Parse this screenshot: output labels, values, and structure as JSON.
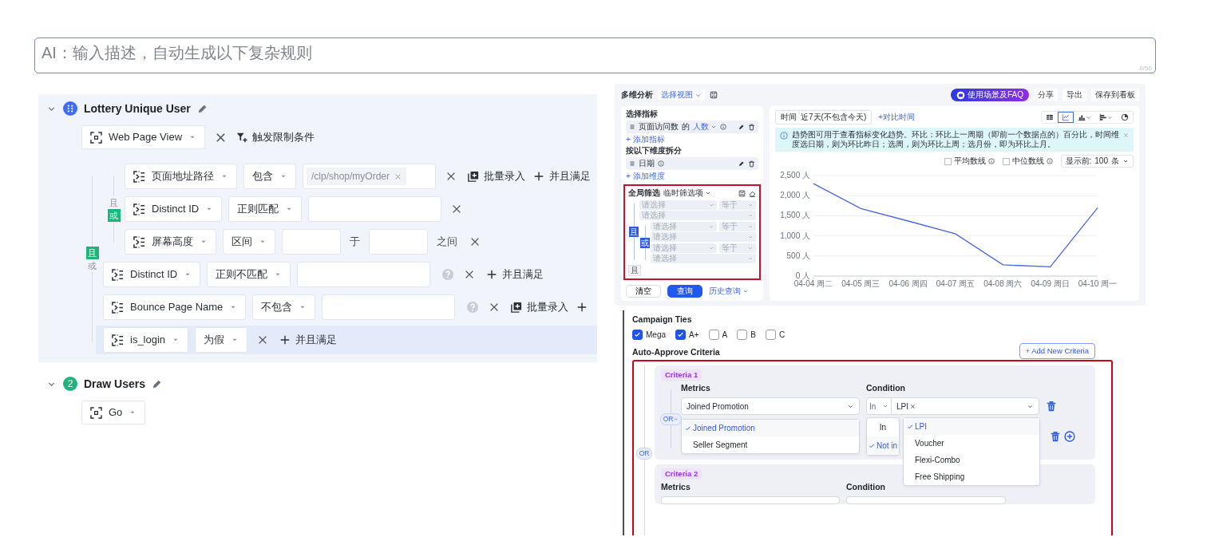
{
  "prompt_box": {
    "placeholder": "AI：输入描述，自动生成以下复杂规则",
    "counter": "0/50"
  },
  "rule_groups": [
    {
      "kind": "icon",
      "title": "Lottery Unique User",
      "expanded": true,
      "active": true,
      "event": {
        "label": "Web Page View"
      },
      "trigger_action": "触发限制条件",
      "conditions": {
        "logic": [
          {
            "label": "且",
            "selected": true
          },
          {
            "label": "或",
            "selected": false
          }
        ],
        "children": [
          {
            "logic": [
              {
                "label": "且",
                "selected": false
              },
              {
                "label": "或",
                "selected": true
              }
            ],
            "children": [
              {
                "highlighted": false,
                "parts": [
                  {
                    "kind": "field",
                    "text": "页面地址路径"
                  },
                  {
                    "kind": "operator",
                    "text": "包含"
                  },
                  {
                    "kind": "tags",
                    "tags": [
                      "/clp/shop/myOrder"
                    ]
                  },
                  {
                    "kind": "remove"
                  },
                  {
                    "kind": "bulk",
                    "text": "批量录入"
                  },
                  {
                    "kind": "add",
                    "text": "并且满足"
                  }
                ]
              },
              {
                "highlighted": false,
                "parts": [
                  {
                    "kind": "field",
                    "text": "Distinct ID"
                  },
                  {
                    "kind": "operator",
                    "text": "正则匹配"
                  },
                  {
                    "kind": "input"
                  },
                  {
                    "kind": "remove"
                  }
                ]
              },
              {
                "highlighted": false,
                "parts": [
                  {
                    "kind": "field",
                    "text": "屏幕高度"
                  },
                  {
                    "kind": "operator",
                    "text": "区间"
                  },
                  {
                    "kind": "range-input"
                  },
                  {
                    "kind": "text",
                    "text": "于"
                  },
                  {
                    "kind": "range-input"
                  },
                  {
                    "kind": "text",
                    "text": "之间"
                  },
                  {
                    "kind": "remove"
                  }
                ]
              }
            ]
          },
          {
            "highlighted": false,
            "parts": [
              {
                "kind": "field",
                "text": "Distinct ID"
              },
              {
                "kind": "operator",
                "text": "正则不匹配"
              },
              {
                "kind": "input"
              },
              {
                "kind": "help"
              },
              {
                "kind": "remove"
              },
              {
                "kind": "add",
                "text": "并且满足"
              }
            ]
          },
          {
            "highlighted": false,
            "parts": [
              {
                "kind": "field",
                "text": "Bounce Page Name"
              },
              {
                "kind": "operator",
                "text": "不包含"
              },
              {
                "kind": "input"
              },
              {
                "kind": "help"
              },
              {
                "kind": "remove"
              },
              {
                "kind": "bulk",
                "text": "批量录入"
              },
              {
                "kind": "add"
              }
            ]
          },
          {
            "highlighted": true,
            "parts": [
              {
                "kind": "field",
                "text": "is_login"
              },
              {
                "kind": "operator",
                "text": "为假"
              },
              {
                "kind": "remove"
              },
              {
                "kind": "add",
                "text": "并且满足"
              }
            ]
          }
        ]
      }
    },
    {
      "kind": "number",
      "badge": "2",
      "title": "Draw Users",
      "expanded": true,
      "active": false,
      "event": {
        "label": "Go"
      }
    }
  ],
  "analytics_view": {
    "title": "多维分析",
    "view_select": "选择视图",
    "header_buttons": [
      {
        "kind": "faq",
        "label": "使用场景及FAQ"
      },
      {
        "kind": "plain",
        "label": "分享"
      },
      {
        "kind": "plain",
        "label": "导出"
      },
      {
        "kind": "plain",
        "label": "保存到看板"
      }
    ],
    "metrics": {
      "heading": "选择指标",
      "items": [
        {
          "name": "页面访问数",
          "joiner": "的",
          "measure": "人数"
        }
      ],
      "add_link": "+ 添加指标"
    },
    "dimensions": {
      "heading": "按以下维度拆分",
      "items": [
        {
          "name": "日期"
        }
      ],
      "add_link": "+ 添加维度"
    },
    "global_filter": {
      "heading": "全局筛选",
      "mode": "临时筛选项",
      "highlighted": true,
      "group": {
        "logic": "且",
        "children": [
          {
            "field": {
              "placeholder": "请选择"
            },
            "operator": "等于",
            "value": {
              "placeholder": "请选择"
            }
          },
          {
            "logic": "或",
            "children": [
              {
                "field": {
                  "placeholder": "请选择"
                },
                "operator": "等于",
                "value": {
                  "placeholder": "请选择"
                }
              },
              {
                "field": {
                  "placeholder": "请选择"
                },
                "operator": "等于",
                "value": {
                  "placeholder": "请选择"
                }
              }
            ]
          }
        ]
      },
      "add_logic": "且"
    },
    "actions": [
      {
        "kind": "outline",
        "label": "清空"
      },
      {
        "kind": "primary",
        "label": "查询"
      },
      {
        "kind": "link",
        "label": "历史查询"
      }
    ],
    "time_label": "时间",
    "time_value": "近7天(不包含今天)",
    "compare_link": "+对比时间",
    "chart_types": [
      {
        "kind": "table",
        "selected": false
      },
      {
        "kind": "line",
        "selected": true
      },
      {
        "kind": "bar",
        "selected": false
      },
      {
        "kind": "hbar",
        "selected": false
      },
      {
        "kind": "pie",
        "selected": false
      }
    ],
    "notice": "趋势图可用于查看指标变化趋势。环比：环比上一周期（即前一个数据点的）百分比，时间维度选日期，则为环比昨日；选周，则为环比上周；选月份，即为环比上月。",
    "reference_lines": [
      {
        "label": "平均数线",
        "checked": false
      },
      {
        "label": "中位数线",
        "checked": false
      }
    ],
    "top_select": {
      "label": "显示前:",
      "value": "100",
      "unit": "条"
    },
    "chart_data": {
      "type": "line",
      "categories": [
        "04-04 周二",
        "04-05 周三",
        "04-06 周四",
        "04-07 周五",
        "04-08 周六",
        "04-09 周日",
        "04-10 周一"
      ],
      "series": [
        {
          "color": "#4a66e8",
          "values": [
            2300,
            1680,
            1370,
            1050,
            280,
            230,
            1700
          ]
        }
      ],
      "ylim": [
        0,
        2500
      ],
      "grid": true,
      "yticks": [
        {
          "value": 0,
          "label": "0 人"
        },
        {
          "value": 500,
          "label": "500 人"
        },
        {
          "value": 1000,
          "label": "1,000 人"
        },
        {
          "value": 1500,
          "label": "1,500 人"
        },
        {
          "value": 2000,
          "label": "2,000 人"
        },
        {
          "value": 2500,
          "label": "2,500 人"
        }
      ]
    }
  },
  "approval_form": {
    "tiers_label": "Campaign Ties",
    "tiers": [
      {
        "label": "Mega",
        "checked": true
      },
      {
        "label": "A+",
        "checked": true
      },
      {
        "label": "A",
        "checked": false
      },
      {
        "label": "B",
        "checked": false
      },
      {
        "label": "C",
        "checked": false
      }
    ],
    "criteria_label": "Auto-Approve Criteria",
    "add_button": "+ Add New Criteria",
    "highlighted": true,
    "outer_logic": "OR",
    "criteria": [
      {
        "tag": "Criteria 1",
        "metrics_label": "Metrics",
        "condition_label": "Condition",
        "metric": "Joined Promotion",
        "operator": "In",
        "values": [
          "LPI"
        ],
        "inner_logic": "OR",
        "metric_options": [
          {
            "label": "Joined Promotion",
            "selected": true
          },
          {
            "label": "Seller Segment",
            "selected": false
          }
        ],
        "operator_options": [
          {
            "label": "In",
            "selected": false
          },
          {
            "label": "Not in",
            "selected": true
          }
        ],
        "value_options": [
          {
            "label": "LPI",
            "selected": true
          },
          {
            "label": "Voucher",
            "selected": false
          },
          {
            "label": "Flexi-Combo",
            "selected": false
          },
          {
            "label": "Free Shipping",
            "selected": false
          }
        ]
      },
      {
        "tag": "Criteria 2",
        "metrics_label": "Metrics",
        "condition_label": "Condition"
      }
    ]
  }
}
